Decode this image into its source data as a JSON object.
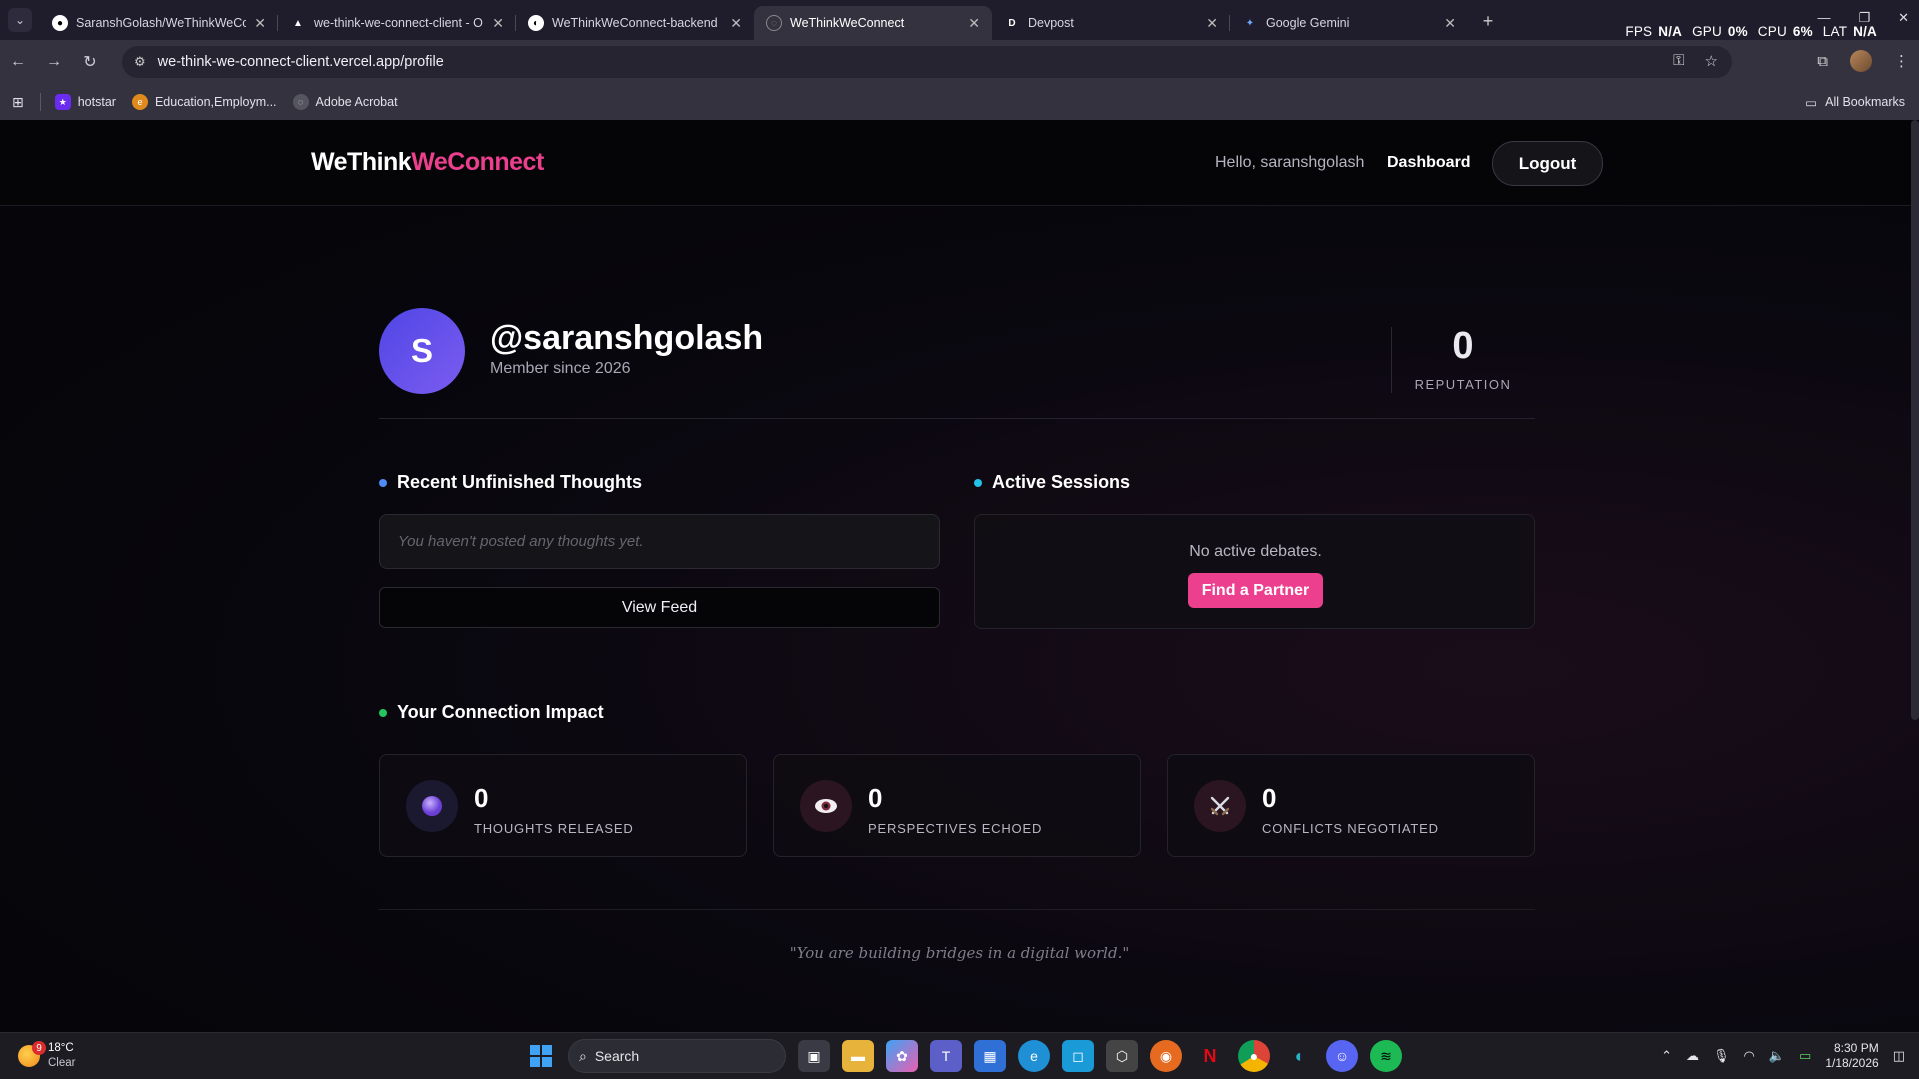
{
  "browser": {
    "tabs": [
      {
        "title": "SaranshGolash/WeThinkWeCon",
        "icon": "github-icon",
        "active": false
      },
      {
        "title": "we-think-we-connect-client - O",
        "icon": "vercel-icon",
        "active": false
      },
      {
        "title": "WeThinkWeConnect-backend",
        "icon": "render-icon",
        "active": false
      },
      {
        "title": "WeThinkWeConnect",
        "icon": "globe-icon",
        "active": true
      },
      {
        "title": "Devpost",
        "icon": "devpost-icon",
        "active": false
      },
      {
        "title": "Google Gemini",
        "icon": "gemini-icon",
        "active": false
      }
    ],
    "perf": {
      "fps_label": "FPS",
      "fps": "N/A",
      "gpu_label": "GPU",
      "gpu": "0%",
      "cpu_label": "CPU",
      "cpu": "6%",
      "lat_label": "LAT",
      "lat": "N/A"
    },
    "url": "we-think-we-connect-client.vercel.app/profile",
    "bookmarks": [
      {
        "label": "hotstar",
        "icon": "hotstar-icon",
        "color": "#6a2cf0"
      },
      {
        "label": "Education,Employm...",
        "icon": "education-icon",
        "color": "#e08a1e"
      },
      {
        "label": "Adobe Acrobat",
        "icon": "globe-icon",
        "color": "#555560"
      }
    ],
    "all_bookmarks": "All Bookmarks"
  },
  "nav": {
    "logo_part1": "WeThink",
    "logo_part2": "WeConnect",
    "greeting": "Hello, saranshgolash",
    "dashboard": "Dashboard",
    "logout": "Logout"
  },
  "profile": {
    "initial": "S",
    "username": "@saranshgolash",
    "member_since": "Member since 2026",
    "reputation_value": "0",
    "reputation_label": "REPUTATION"
  },
  "thoughts": {
    "title": "Recent Unfinished Thoughts",
    "empty": "You haven't posted any thoughts yet.",
    "view_feed": "View Feed"
  },
  "sessions": {
    "title": "Active Sessions",
    "empty": "No active debates.",
    "find_partner": "Find a Partner"
  },
  "impact": {
    "title": "Your Connection Impact",
    "cards": [
      {
        "value": "0",
        "label": "THOUGHTS RELEASED",
        "icon": "purple-orb-icon"
      },
      {
        "value": "0",
        "label": "PERSPECTIVES ECHOED",
        "icon": "eye-icon"
      },
      {
        "value": "0",
        "label": "CONFLICTS NEGOTIATED",
        "icon": "crossed-swords-icon"
      }
    ]
  },
  "quote": "\"You are building bridges in a digital world.\"",
  "colors": {
    "accent_pink": "#ec3f8e",
    "dot_blue": "#4f8cf5",
    "dot_cyan": "#22c3e6",
    "dot_green": "#22c55e"
  },
  "taskbar": {
    "weather_temp": "18°C",
    "weather_desc": "Clear",
    "weather_badge": "9",
    "search_placeholder": "Search",
    "time": "8:30 PM",
    "date": "1/18/2026"
  }
}
